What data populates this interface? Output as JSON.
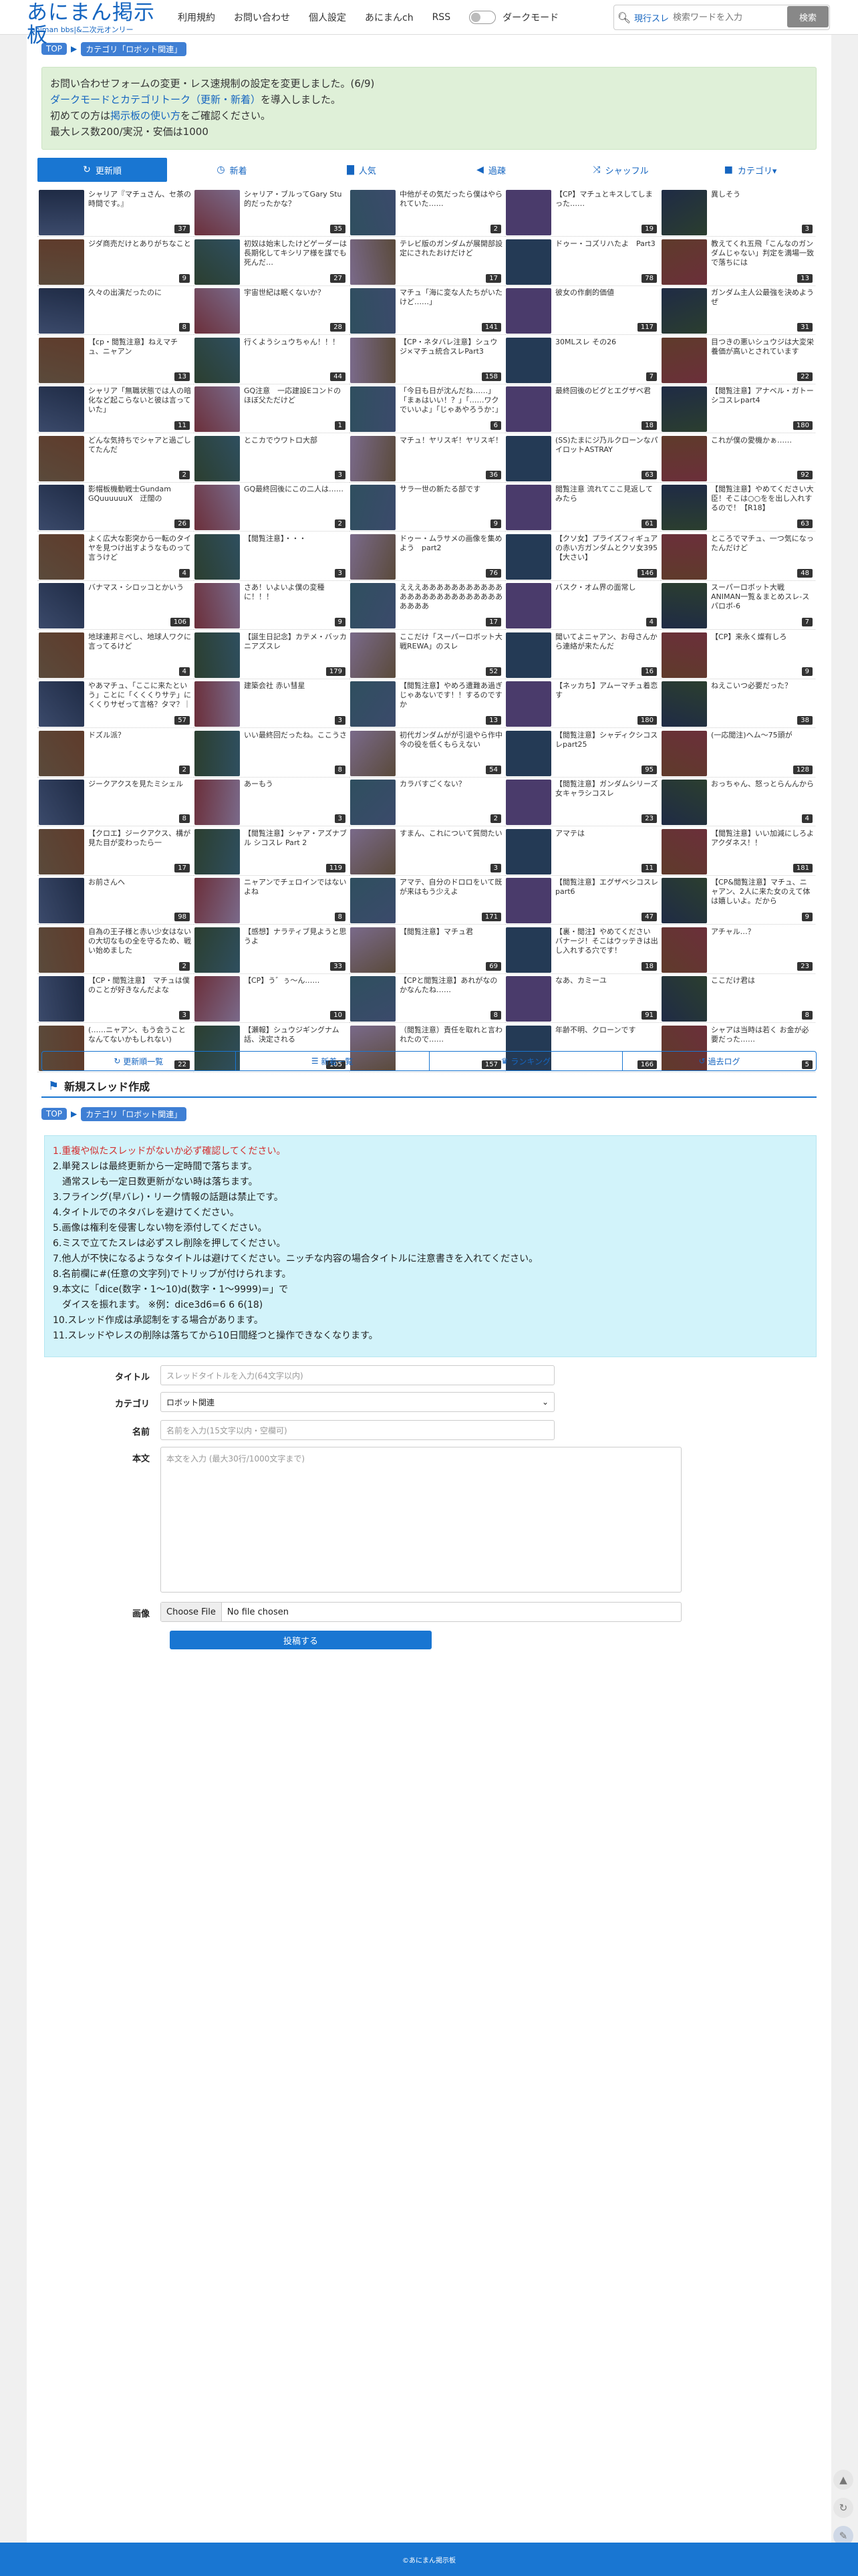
{
  "header": {
    "logo_title": "あにまん掲示板",
    "logo_subtitle": "animan bbs|&二次元オンリー",
    "nav": [
      "利用規約",
      "お問い合わせ",
      "個人設定",
      "あにまんch",
      "RSS"
    ],
    "dark_mode_label": "ダークモード",
    "search": {
      "scope": "現行スレ",
      "placeholder": "検索ワードを入力",
      "button": "検索"
    }
  },
  "breadcrumb": [
    "TOP",
    "カテゴリ「ロボット関連」"
  ],
  "notice": {
    "line1": "お問い合わせフォームの変更・レス速規制の設定を変更しました。(6/9)",
    "line2_link": "ダークモードとカテゴリトーク（更新・新着）",
    "line2_rest": "を導入しました。",
    "line3_pre": "初めての方は",
    "line3_link": "掲示板の使い方",
    "line3_rest": "をご確認ください。",
    "line4": "最大レス数200/実況・安価は1000"
  },
  "tabs": [
    {
      "label": "更新順",
      "icon": "refresh-icon",
      "active": true
    },
    {
      "label": "新着",
      "icon": "clock-icon",
      "active": false
    },
    {
      "label": "人気",
      "icon": "bar-chart-icon",
      "active": false
    },
    {
      "label": "過疎",
      "icon": "speaker-icon",
      "active": false
    },
    {
      "label": "シャッフル",
      "icon": "shuffle-icon",
      "active": false
    },
    {
      "label": "カテゴリ▾",
      "icon": "folder-icon",
      "active": false
    }
  ],
  "threads": [
    {
      "t": "シャリア『マチュさん、セ茶の時間です。』",
      "n": "37"
    },
    {
      "t": "シャリア・ブルってGary Stu的だったかな？",
      "n": "35"
    },
    {
      "t": "中他がその気だったら僕はやられていた……",
      "n": "2"
    },
    {
      "t": "【CP】マチュとキスしてしまった……",
      "n": "19"
    },
    {
      "t": "異しそう",
      "n": "3"
    },
    {
      "t": "ジダ商売だけとありがちなこと",
      "n": "9"
    },
    {
      "t": "初奴は始末したけどゲーダーは長期化してキシリア様を謀でも死んだ…",
      "n": "27"
    },
    {
      "t": "テレビ版のガンダムが展開部設定にされたおけだけど",
      "n": "17"
    },
    {
      "t": "ドゥー・コズリハたよ　Part3",
      "n": "78"
    },
    {
      "t": "教えてくれ五飛「こんなのガンダムじゃない」判定を満場一致で落ちには",
      "n": "13"
    },
    {
      "t": "久々の出演だったのに",
      "n": "8"
    },
    {
      "t": "宇宙世紀は眠くないか？",
      "n": "28"
    },
    {
      "t": "マチュ「海に変な人たちがいたけど……」",
      "n": "141"
    },
    {
      "t": "彼女の作劇的価値",
      "n": "117"
    },
    {
      "t": "ガンダム主人公最強を決めようぜ",
      "n": "31"
    },
    {
      "t": "【cp・閲覧注意】ねえマチュ、ニャアン",
      "n": "13"
    },
    {
      "t": "行くようシュウちゃん！！！",
      "n": "44"
    },
    {
      "t": "【CP・ネタバレ注意】シュウジ×マチュ統合スレPart3",
      "n": "158"
    },
    {
      "t": "30MLスレ その26",
      "n": "7"
    },
    {
      "t": "目つきの悪いシュウジは大変栄養価が高いとされています",
      "n": "22"
    },
    {
      "t": "シャリア「無職状態では人の暗化など起こらないと彼は言っていた」",
      "n": "11"
    },
    {
      "t": "GQ注意　一応建設Eコンドのほぼ父ただけど",
      "n": "1"
    },
    {
      "t": "「今日も日が沈んだね……」「まぁはいい！？」「……ワクでいいよ」「じゃあやろうか：」",
      "n": "6"
    },
    {
      "t": "最終回後のビグとエグザベ君",
      "n": "18"
    },
    {
      "t": "【閲覧注意】アナベル・ガトーシコスレpart4",
      "n": "180"
    },
    {
      "t": "どんな気持ちでシャアと過ごしてたんだ",
      "n": "2"
    },
    {
      "t": "とこカでウワトロ大部",
      "n": "3"
    },
    {
      "t": "マチュ！ヤリスギ！ヤリスギ！",
      "n": "36"
    },
    {
      "t": "(SS)たまにジ乃ルクローンなパイロットASTRAY",
      "n": "63"
    },
    {
      "t": "これが僕の愛機かぁ……",
      "n": "92"
    },
    {
      "t": "影帽板機動戦士Gundam GQuuuuuuX　迂闊の",
      "n": "26"
    },
    {
      "t": "GQ最終回後にこの二人は……",
      "n": "2"
    },
    {
      "t": "サラ一世の新たる部です",
      "n": "9"
    },
    {
      "t": "閲覧注意 流れてここ見返してみたら",
      "n": "61"
    },
    {
      "t": "【閲覧注意】やめてください大臣！そこは○○をを出し入れするので！【R18】",
      "n": "63"
    },
    {
      "t": "よく広大な影突から一転のタイヤを見つけ出すようなものって言うけど",
      "n": "4"
    },
    {
      "t": "【閲覧注意】・・・",
      "n": "3"
    },
    {
      "t": "ドゥー・ムラサメの画像を集めよう　part2",
      "n": "76"
    },
    {
      "t": "【クソ女】プライズフィギュアの赤い方ガンダムとクソ女395 【大さい】",
      "n": "146"
    },
    {
      "t": "ところでマチュ、一つ気になったんだけど",
      "n": "48"
    },
    {
      "t": "バナマス・シロッコとかいう",
      "n": "106"
    },
    {
      "t": "さあ！いよいよ僕の変種に！！！",
      "n": "9"
    },
    {
      "t": "えええあああああああああああああああああああああああああああああ",
      "n": "17"
    },
    {
      "t": "バスク・オム界の面常し",
      "n": "4"
    },
    {
      "t": "スーパーロボット大戦ANIMAN一覧＆まとめスレ-スパロボ-6",
      "n": "7"
    },
    {
      "t": "地球連邦ミべし、地球人ワクに言ってるけど",
      "n": "4"
    },
    {
      "t": "【誕生日記念】カテメ・バッカニアズスレ",
      "n": "179"
    },
    {
      "t": "ここだけ「スーパーロボット大戦REWA」のスレ",
      "n": "52"
    },
    {
      "t": "聞いてよニャアン、お母さんから連絡が来たんだ",
      "n": "16"
    },
    {
      "t": "【CP】来永く燦有しろ",
      "n": "9"
    },
    {
      "t": "やあマチュ、「ここに来たという」ことに「くくくりサテ」にくくりサゼって言格？タマ？｜part5",
      "n": "57"
    },
    {
      "t": "建築会社 赤い彗星",
      "n": "3"
    },
    {
      "t": "【閲覧注意】やめろ遭難あ過ぎじゃあないです！！するのですか",
      "n": "13"
    },
    {
      "t": "【ネッカち】アムーマチュ着恋す",
      "n": "180"
    },
    {
      "t": "ねえこいつ必要だった？",
      "n": "38"
    },
    {
      "t": "ドズル派？",
      "n": "2"
    },
    {
      "t": "いい最終回だったね。ここうさ",
      "n": "8"
    },
    {
      "t": "初代ガンダムがが引退やら作中今の役を低くもらえない",
      "n": "54"
    },
    {
      "t": "【閲覧注意】シャディクシコスレpart25",
      "n": "95"
    },
    {
      "t": "(一応閲注)ヘム～75頭が",
      "n": "128"
    },
    {
      "t": "ジークアクスを見たミシェル",
      "n": "8"
    },
    {
      "t": "あーもう",
      "n": "3"
    },
    {
      "t": "カラバすごくない？",
      "n": "2"
    },
    {
      "t": "【閲覧注意】ガンダムシリーズ女キャラシコスレ",
      "n": "23"
    },
    {
      "t": "おっちゃん、怒っとらんんから",
      "n": "4"
    },
    {
      "t": "【クロエ】ジークアクス、構が見た目が変わったら一",
      "n": "17"
    },
    {
      "t": "【閲覧注意】シャア・アズナブル シコスレ Part 2",
      "n": "119"
    },
    {
      "t": "すまん、これについて質問たい",
      "n": "3"
    },
    {
      "t": "アマテは",
      "n": "11"
    },
    {
      "t": "【閲覧注意】いい加減にしろよアクダネス！！",
      "n": "181"
    },
    {
      "t": "お前さんへ",
      "n": "98"
    },
    {
      "t": "ニャアンでチェロインではないよね",
      "n": "8"
    },
    {
      "t": "アマテ、自分のドロロをいて既が来はもう少えよ",
      "n": "171"
    },
    {
      "t": "【閲覧注意】エグザベシコスレpart6",
      "n": "47"
    },
    {
      "t": "【CP&閲覧注意】マチュ、ニャアン、2人に来た女のえて体は嬉しいよ。だから",
      "n": "9"
    },
    {
      "t": "自為の王子様と赤い少女はないの大切なもの全を守るため、戦い始めました",
      "n": "2"
    },
    {
      "t": "【感想】ナラティブ見ようと思うよ",
      "n": "33"
    },
    {
      "t": "【閲覧注意】マチュ君",
      "n": "69"
    },
    {
      "t": "【裏・閲注】やめてください バナージ！そこはウッテきは出し入れする穴です！",
      "n": "18"
    },
    {
      "t": "アチャル…？",
      "n": "23"
    },
    {
      "t": "【CP・閲覧注意】　マチュは僕のことが好きなんだよな",
      "n": "3"
    },
    {
      "t": "【CP】う゛ぅ〜ん……",
      "n": "10"
    },
    {
      "t": "【CPと閲覧注意】あれがなのかなんたね……",
      "n": "8"
    },
    {
      "t": "なあ、カミーユ",
      "n": "91"
    },
    {
      "t": "ここだけ君は",
      "n": "8"
    },
    {
      "t": "(……ニャアン、もう会うことなんてないかもしれない)",
      "n": "22"
    },
    {
      "t": "【瀬報】シュウジギングナム話、決定される",
      "n": "105"
    },
    {
      "t": "（閲覧注意）責任を取れと言われたので……",
      "n": "157"
    },
    {
      "t": "年齢不明、クローンです",
      "n": "166"
    },
    {
      "t": "シャアは当時は若く お金が必要だった……",
      "n": "5"
    }
  ],
  "links": [
    {
      "label": "更新順一覧",
      "icon": "refresh-icon"
    },
    {
      "label": "新着一覧",
      "icon": "list-icon"
    },
    {
      "label": "ランキング",
      "icon": "crown-icon"
    },
    {
      "label": "過去ログ",
      "icon": "history-icon"
    }
  ],
  "create": {
    "title": "新規スレッド作成",
    "breadcrumb": [
      "TOP",
      "カテゴリ「ロボット関連」"
    ],
    "rules": [
      {
        "text": "1.重複や似たスレッドがないか必ず確認してください。",
        "red": true
      },
      {
        "text": "2.単発スレは最終更新から一定時間で落ちます。",
        "red": false
      },
      {
        "text": "　通常スレも一定日数更新がない時は落ちます。",
        "red": false
      },
      {
        "text": "3.フライング(早バレ)・リーク情報の話題は禁止です。",
        "red": false
      },
      {
        "text": "4.タイトルでのネタバレを避けてください。",
        "red": false
      },
      {
        "text": "5.画像は権利を侵害しない物を添付してください。",
        "red": false
      },
      {
        "text": "6.ミスで立てたスレは必ずスレ削除を押してください。",
        "red": false
      },
      {
        "text": "7.他人が不快になるようなタイトルは避けてください。ニッチな内容の場合タイトルに注意書きを入れてください。",
        "red": false
      },
      {
        "text": "8.名前欄に#(任意の文字列)でトリップが付けられます。",
        "red": false
      },
      {
        "text": "9.本文に「dice(数字・1～10)d(数字・1～9999)=」で",
        "red": false
      },
      {
        "text": "　ダイスを振れます。 ※例：dice3d6=6 6 6(18)",
        "red": false
      },
      {
        "text": "10.スレッド作成は承認制をする場合があります。",
        "red": false
      },
      {
        "text": "11.スレッドやレスの削除は落ちてから10日間経つと操作できなくなります。",
        "red": false
      }
    ],
    "form": {
      "title_label": "タイトル",
      "title_placeholder": "スレッドタイトルを入力(64文字以内)",
      "category_label": "カテゴリ",
      "category_value": "ロボット関連",
      "name_label": "名前",
      "name_placeholder": "名前を入力(15文字以内・空欄可)",
      "body_label": "本文",
      "body_placeholder": "本文を入力 (最大30行/1000文字まで)",
      "image_label": "画像",
      "file_button": "Choose File",
      "file_status": "No file chosen",
      "submit": "投稿する"
    }
  },
  "footer": "©あにまん掲示板"
}
